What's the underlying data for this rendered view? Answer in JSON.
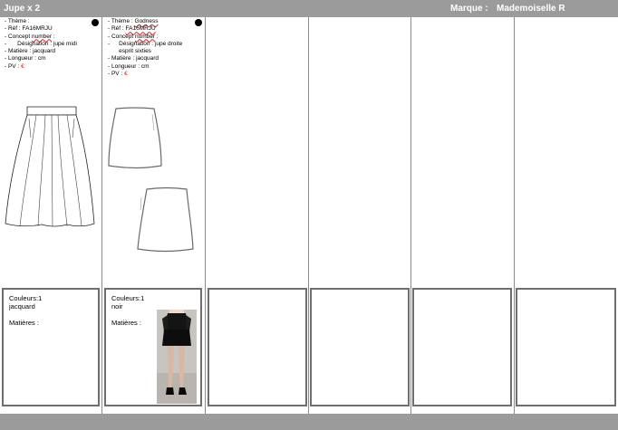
{
  "header": {
    "title": "Jupe x 2",
    "brand_label": "Marque :",
    "brand_value": "Mademoiselle R"
  },
  "products": [
    {
      "theme_label": "- Thème :",
      "theme_value": "",
      "ref_label": "- Réf : ",
      "ref_value": "FA16MRJU",
      "concept_prefix": "-  Concept ",
      "concept_word": "number",
      "concept_suffix": " :",
      "designation_bullet": "-",
      "designation_label": "Désignation : ",
      "designation_value": "jupe midi",
      "matiere_label": "- Matière : ",
      "matiere_value": "jacquard",
      "longueur_label": "- Longueur : ",
      "longueur_value": "cm",
      "pv_label": "- PV : ",
      "pv_currency": "€",
      "couleurs_label": "Couleurs:",
      "couleurs_count": "1",
      "couleur_name": "jacquard",
      "matieres_label": "Matières :"
    },
    {
      "theme_label": "- Thème : ",
      "theme_value": "Godness",
      "ref_label": "- Réf : ",
      "ref_value": "FA16MRJU",
      "concept_prefix": "-  Concept ",
      "concept_word": "number",
      "concept_suffix": " :",
      "designation_bullet": "-",
      "designation_label": "Désignation : ",
      "designation_value": "jupe droite esprit sixties",
      "matiere_label": "- Matière : ",
      "matiere_value": "jacquard",
      "longueur_label": "- Longueur : ",
      "longueur_value": "cm",
      "pv_label": "- PV : ",
      "pv_currency": "€",
      "couleurs_label": "Couleurs:",
      "couleurs_count": "1",
      "couleur_name": "noir",
      "matieres_label": "Matières :"
    }
  ],
  "colors": {
    "bar": "#9b9b9b",
    "box_border": "#6e6e6e",
    "accent_red": "#e02020"
  }
}
